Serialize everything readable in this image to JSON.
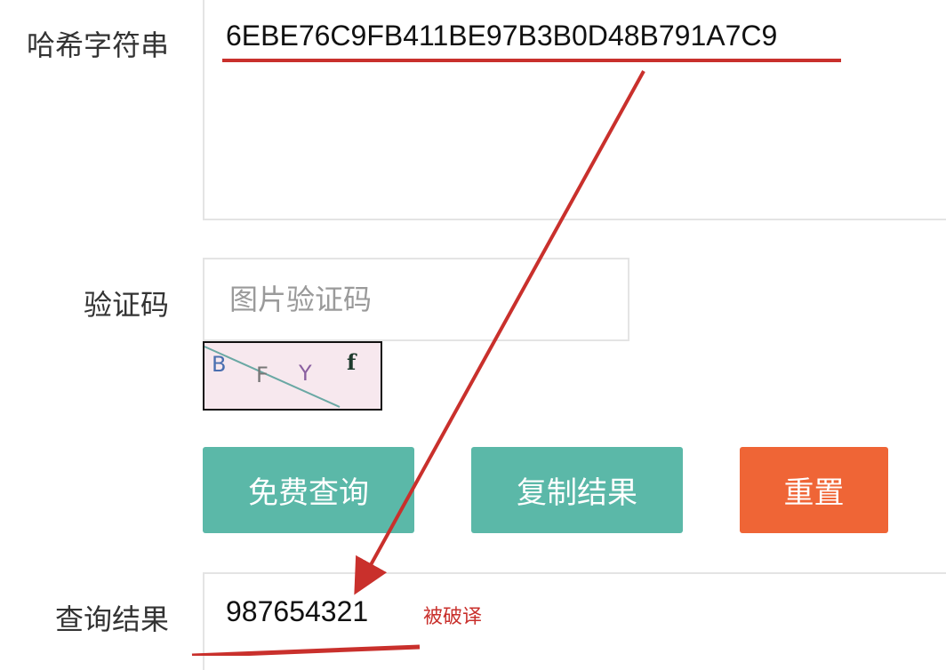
{
  "form": {
    "hash_label": "哈希字符串",
    "hash_value": "6EBE76C9FB411BE97B3B0D48B791A7C9",
    "captcha_label": "验证码",
    "captcha_placeholder": "图片验证码",
    "captcha_image_text": [
      "B",
      "F",
      "Y",
      "f"
    ],
    "result_label": "查询结果",
    "result_value": "987654321"
  },
  "buttons": {
    "query": "免费查询",
    "copy": "复制结果",
    "reset": "重置"
  },
  "annotation": {
    "cracked_note": "被破译",
    "color": "#c9302c"
  },
  "colors": {
    "primary_button": "#5bb8a8",
    "reset_button": "#ef6536"
  }
}
